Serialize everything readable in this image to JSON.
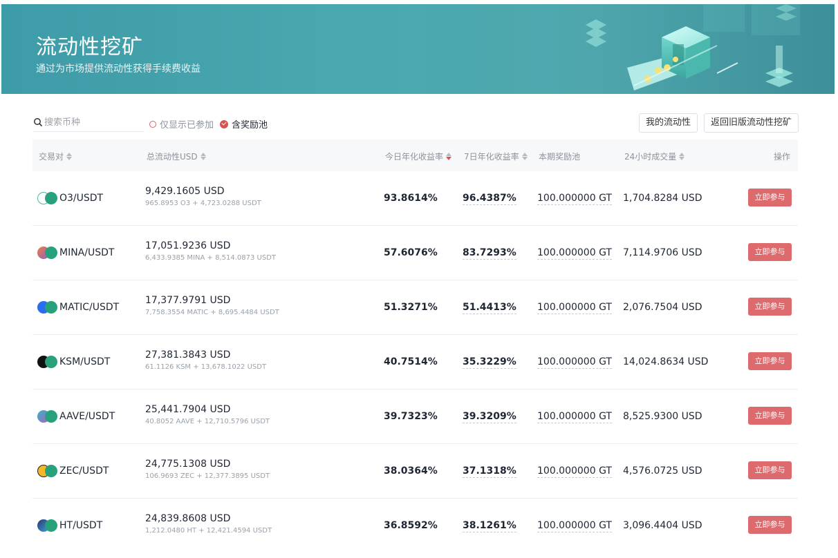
{
  "banner": {
    "title": "流动性挖矿",
    "subtitle": "通过为市场提供流动性获得手续费收益"
  },
  "toolbar": {
    "search_placeholder": "搜索币种",
    "filter_joined": "仅显示已参加",
    "filter_reward": "含奖励池",
    "my_liquidity": "我的流动性",
    "back_old": "返回旧版流动性挖矿"
  },
  "table": {
    "headers": {
      "pair": "交易对",
      "total_liquidity": "总流动性USD",
      "today_apr": "今日年化收益率",
      "week_apr": "7日年化收益率",
      "reward_pool": "本期奖励池",
      "volume_24h": "24小时成交量",
      "action": "操作"
    },
    "join_label": "立即参与",
    "rows": [
      {
        "pair": "O3/USDT",
        "liquidity": "9,429.1605 USD",
        "composition": "965.8953 O3 + 4,723.0288 USDT",
        "today_apr": "93.8614%",
        "week_apr": "96.4387%",
        "reward": "100.000000 GT",
        "volume": "1,704.8284 USD"
      },
      {
        "pair": "MINA/USDT",
        "liquidity": "17,051.9236 USD",
        "composition": "6,433.9385 MINA + 8,514.0873 USDT",
        "today_apr": "57.6076%",
        "week_apr": "83.7293%",
        "reward": "100.000000 GT",
        "volume": "7,114.9706 USD"
      },
      {
        "pair": "MATIC/USDT",
        "liquidity": "17,377.9791 USD",
        "composition": "7,758.3554 MATIC + 8,695.4484 USDT",
        "today_apr": "51.3271%",
        "week_apr": "51.4413%",
        "reward": "100.000000 GT",
        "volume": "2,076.7504 USD"
      },
      {
        "pair": "KSM/USDT",
        "liquidity": "27,381.3843 USD",
        "composition": "61.1126 KSM + 13,678.1022 USDT",
        "today_apr": "40.7514%",
        "week_apr": "35.3229%",
        "reward": "100.000000 GT",
        "volume": "14,024.8634 USD"
      },
      {
        "pair": "AAVE/USDT",
        "liquidity": "25,441.7904 USD",
        "composition": "40.8052 AAVE + 12,710.5796 USDT",
        "today_apr": "39.7323%",
        "week_apr": "39.3209%",
        "reward": "100.000000 GT",
        "volume": "8,525.9300 USD"
      },
      {
        "pair": "ZEC/USDT",
        "liquidity": "24,775.1308 USD",
        "composition": "106.9693 ZEC + 12,377.3895 USDT",
        "today_apr": "38.0364%",
        "week_apr": "37.1318%",
        "reward": "100.000000 GT",
        "volume": "4,576.0725 USD"
      },
      {
        "pair": "HT/USDT",
        "liquidity": "24,839.8608 USD",
        "composition": "1,212.0480 HT + 12,421.4594 USDT",
        "today_apr": "36.8592%",
        "week_apr": "38.1261%",
        "reward": "100.000000 GT",
        "volume": "3,096.4404 USD"
      }
    ]
  },
  "colors": {
    "banner": "#4aa9b0",
    "join_button": "#dd6b6e",
    "accent_red": "#d9534f",
    "usdt_green": "#26a17b"
  },
  "coin_icons": [
    "o3-coin-icon",
    "mina-coin-icon",
    "matic-coin-icon",
    "ksm-coin-icon",
    "aave-coin-icon",
    "zec-coin-icon",
    "ht-coin-icon"
  ]
}
